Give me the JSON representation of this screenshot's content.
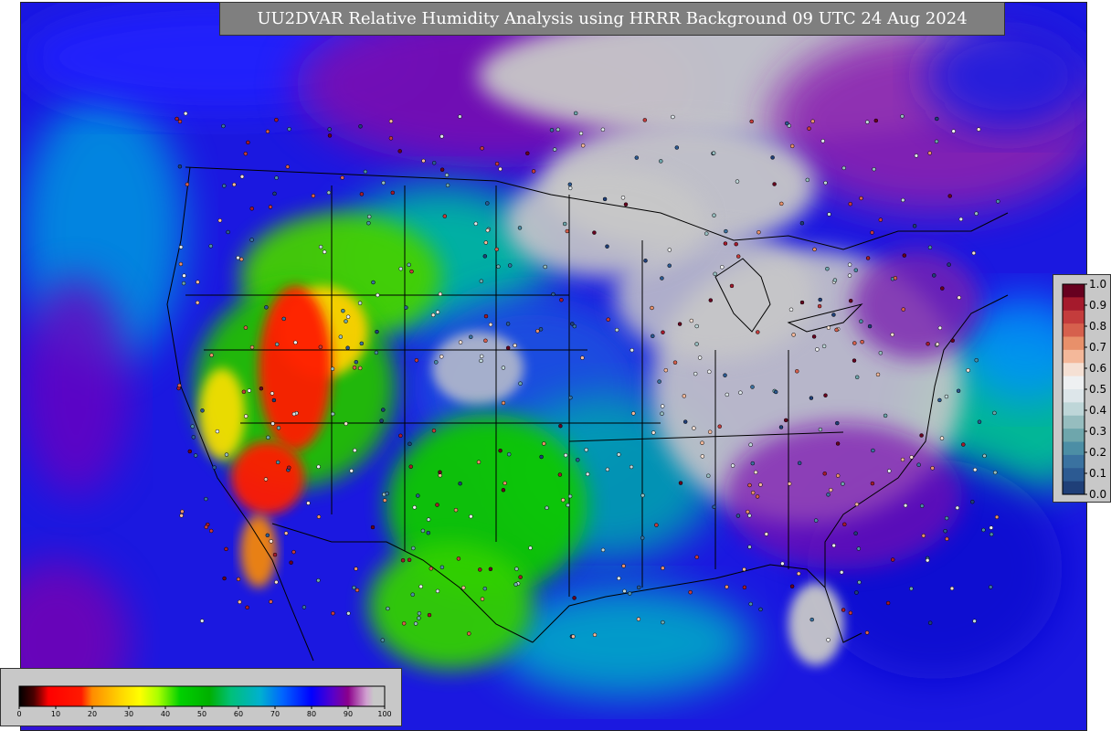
{
  "title": "UU2DVAR Relative Humidity Analysis using HRRR Background 09 UTC 24 Aug 2024",
  "map": {
    "projection": "Lambert conformal, CONUS",
    "field": "Relative Humidity (%)",
    "observations": "station markers colored by ob value"
  },
  "rh_colorbar": {
    "tick_labels": [
      "0",
      "10",
      "20",
      "30",
      "40",
      "50",
      "60",
      "70",
      "80",
      "90",
      "100"
    ],
    "range": [
      0,
      100
    ],
    "stops": [
      {
        "v": 0,
        "c": "#000000"
      },
      {
        "v": 4,
        "c": "#4a0000"
      },
      {
        "v": 6,
        "c": "#a00000"
      },
      {
        "v": 8,
        "c": "#ff0000"
      },
      {
        "v": 17,
        "c": "#ff1a00"
      },
      {
        "v": 20,
        "c": "#ff8c00"
      },
      {
        "v": 28,
        "c": "#ffd700"
      },
      {
        "v": 33,
        "c": "#ffff00"
      },
      {
        "v": 38,
        "c": "#aaff00"
      },
      {
        "v": 44,
        "c": "#00d000"
      },
      {
        "v": 52,
        "c": "#00b000"
      },
      {
        "v": 58,
        "c": "#00c07a"
      },
      {
        "v": 66,
        "c": "#00b0d0"
      },
      {
        "v": 72,
        "c": "#0066ff"
      },
      {
        "v": 80,
        "c": "#0000ff"
      },
      {
        "v": 86,
        "c": "#5a00c8"
      },
      {
        "v": 90,
        "c": "#8b008b"
      },
      {
        "v": 95,
        "c": "#d0a0d0"
      },
      {
        "v": 97,
        "c": "#c8c8c8"
      },
      {
        "v": 100,
        "c": "#c8c8c8"
      }
    ]
  },
  "ob_colorbar": {
    "tick_labels": [
      "1.0",
      "0.9",
      "0.8",
      "0.7",
      "0.6",
      "0.5",
      "0.4",
      "0.3",
      "0.2",
      "0.1",
      "0.0"
    ],
    "range": [
      0.0,
      1.0
    ],
    "colors_top_to_bottom": [
      "#67001f",
      "#a51a2c",
      "#c43c3c",
      "#d6604d",
      "#e8906a",
      "#f4b89a",
      "#f5e0d4",
      "#eef0f2",
      "#dde6ea",
      "#bed6d8",
      "#96bdbf",
      "#6ea6ac",
      "#4c8ea5",
      "#3a72a0",
      "#2c5a92",
      "#1f3f78"
    ]
  },
  "colors": {
    "background_field": "#c8c8c8",
    "moist": "#0000ff",
    "saturated": "#8b008b",
    "dry": "#ff0000",
    "boundaries": "#000000"
  }
}
